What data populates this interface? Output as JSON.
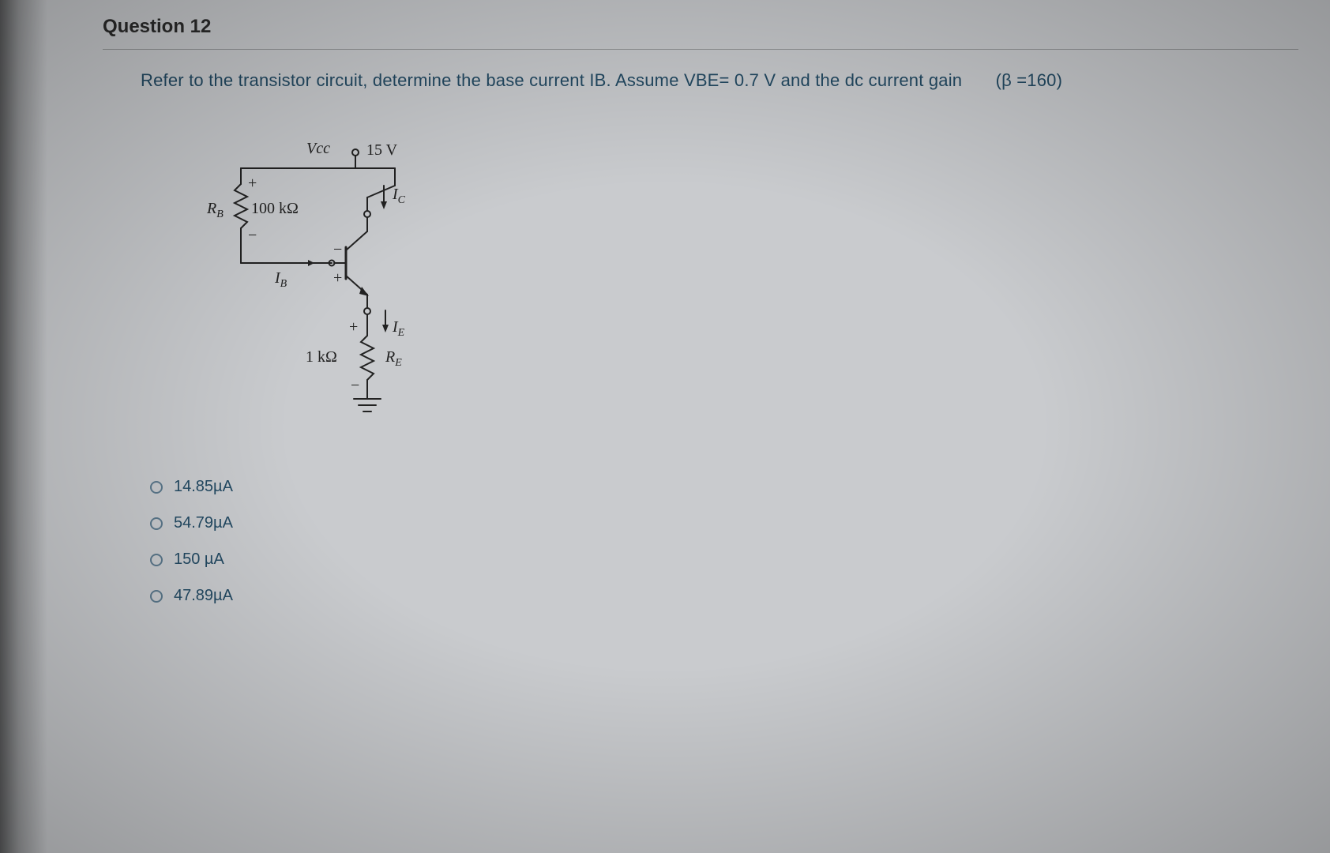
{
  "question": {
    "number_label": "Question 12",
    "prompt_main": "Refer to the transistor circuit, determine the base current IB. Assume VBE= 0.7 V and the dc current gain",
    "prompt_beta": "(β =160)"
  },
  "circuit": {
    "vcc_label": "Vcc",
    "vcc_value": "15 V",
    "rb_label": "R",
    "rb_sub": "B",
    "rb_value": "100 kΩ",
    "ib_label": "I",
    "ib_sub": "B",
    "ic_label": "I",
    "ic_sub": "C",
    "ie_label": "I",
    "ie_sub": "E",
    "re_label": "R",
    "re_sub": "E",
    "re_value": "1 kΩ",
    "plus": "+",
    "minus": "−"
  },
  "options": [
    {
      "label": "14.85µA"
    },
    {
      "label": "54.79µA"
    },
    {
      "label": "150 µA"
    },
    {
      "label": "47.89µA"
    }
  ]
}
